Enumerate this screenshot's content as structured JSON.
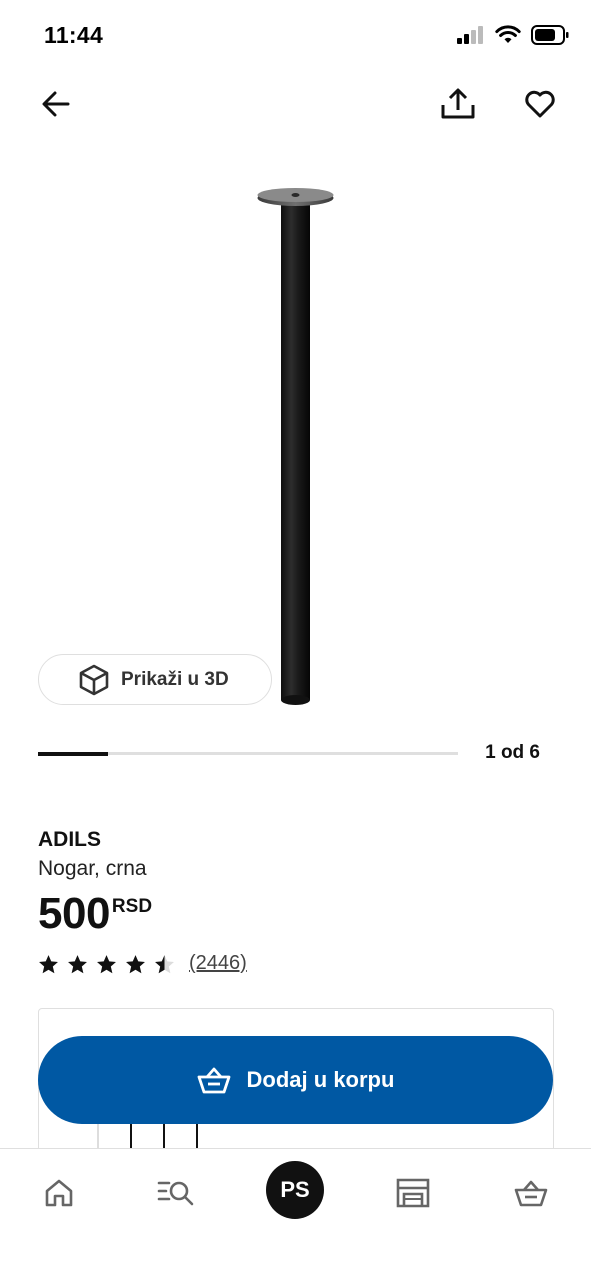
{
  "status_bar": {
    "time": "11:44"
  },
  "header": {
    "back_icon": "arrow-left-icon",
    "share_icon": "share-icon",
    "favorite_icon": "heart-icon"
  },
  "gallery": {
    "view_3d_label": "Prikaži u 3D",
    "counter": "1 od 6",
    "current": 1,
    "total": 6
  },
  "product": {
    "name": "ADILS",
    "description": "Nogar, crna",
    "price": "500",
    "currency": "RSD",
    "rating": 4.5,
    "rating_max": 5,
    "review_count": "(2446)"
  },
  "actions": {
    "add_to_cart_label": "Dodaj u korpu"
  },
  "bottom_nav": {
    "profile_initials": "PS",
    "items": [
      "home-icon",
      "search-icon",
      "profile-avatar",
      "store-icon",
      "cart-icon"
    ]
  },
  "colors": {
    "brand_blue": "#0058a3",
    "text": "#111111",
    "divider": "#dfdfdf"
  }
}
